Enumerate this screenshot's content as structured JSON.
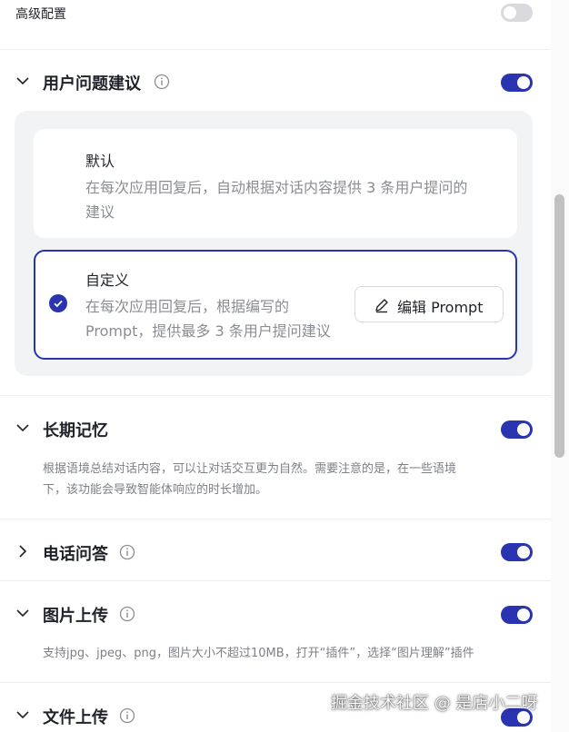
{
  "advanced": {
    "label": "高级配置",
    "enabled": false
  },
  "suggestions": {
    "title": "用户问题建议",
    "enabled": true,
    "options": [
      {
        "title": "默认",
        "desc_line1": "在每次应用回复后，自动根据对话内容提供 3 条用户提问的",
        "desc_line2": "建议",
        "selected": false
      },
      {
        "title": "自定义",
        "desc_line1": "在每次应用回复后，根据编写的",
        "desc_line2": "Prompt，提供最多 3 条用户提问建议",
        "selected": true,
        "edit_label": "编辑 Prompt"
      }
    ]
  },
  "memory": {
    "title": "长期记忆",
    "enabled": true,
    "desc_line1": "根据语境总结对话内容，可以让对话交互更为自然。需要注意的是，在一些语境",
    "desc_line2": "下，该功能会导致智能体响应的时长增加。"
  },
  "phone": {
    "title": "电话问答",
    "enabled": true
  },
  "image": {
    "title": "图片上传",
    "enabled": true,
    "desc": "支持jpg、jpeg、png，图片大小不超过10MB，打开“插件”，选择“图片理解”插件"
  },
  "file": {
    "title": "文件上传",
    "enabled": true
  },
  "watermark": "掘金技术社区 @ 是店小二呀",
  "colors": {
    "accent": "#2a33b0",
    "toggle_off": "#d9d9de"
  }
}
